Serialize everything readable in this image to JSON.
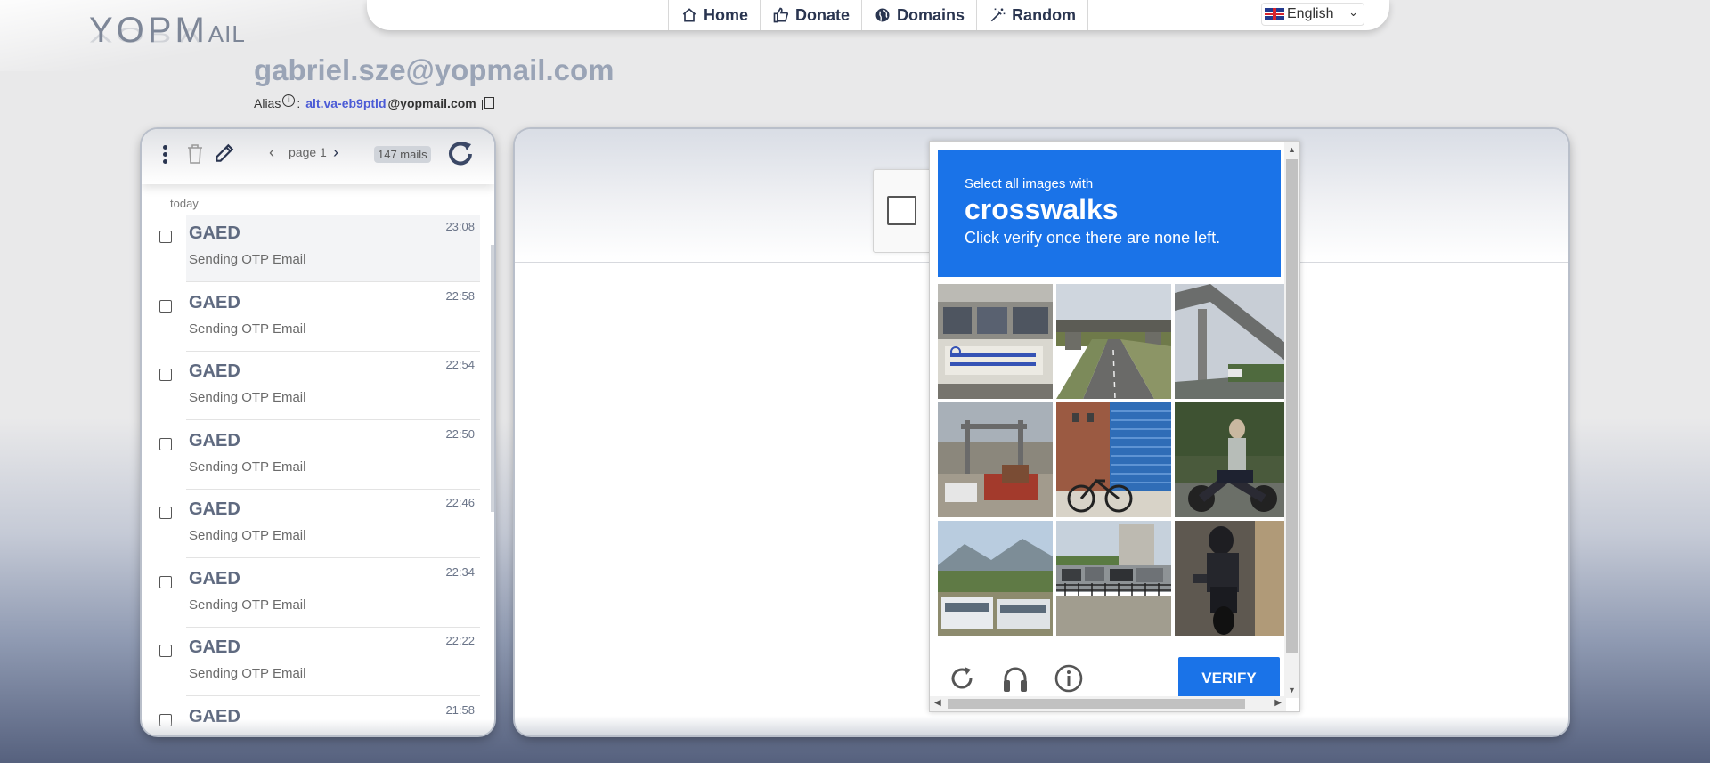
{
  "logo": {
    "text_main": "YOPM",
    "text_small": "AIL"
  },
  "nav": {
    "items": [
      {
        "label": "Home",
        "icon": "home-icon"
      },
      {
        "label": "Donate",
        "icon": "thumbs-up-icon"
      },
      {
        "label": "Domains",
        "icon": "globe-icon"
      },
      {
        "label": "Random",
        "icon": "magic-wand-icon"
      }
    ],
    "language": "English"
  },
  "mailbox": {
    "address": "gabriel.sze@yopmail.com",
    "alias_label": "Alias",
    "alias_sep": ":",
    "alias_name": "alt.va-eb9ptld",
    "alias_domain": "@yopmail.com"
  },
  "inbox": {
    "page_label": "page 1",
    "mail_count": "147 mails",
    "day_label": "today",
    "mails": [
      {
        "from": "GAED",
        "subject": "Sending OTP Email",
        "time": "23:08"
      },
      {
        "from": "GAED",
        "subject": "Sending OTP Email",
        "time": "22:58"
      },
      {
        "from": "GAED",
        "subject": "Sending OTP Email",
        "time": "22:54"
      },
      {
        "from": "GAED",
        "subject": "Sending OTP Email",
        "time": "22:50"
      },
      {
        "from": "GAED",
        "subject": "Sending OTP Email",
        "time": "22:46"
      },
      {
        "from": "GAED",
        "subject": "Sending OTP Email",
        "time": "22:34"
      },
      {
        "from": "GAED",
        "subject": "Sending OTP Email",
        "time": "22:22"
      },
      {
        "from": "GAED",
        "subject": "",
        "time": "21:58"
      }
    ]
  },
  "captcha": {
    "intro": "Select all images with",
    "target": "crosswalks",
    "note": "Click verify once there are none left.",
    "verify_label": "VERIFY",
    "accent": "#1a73e8"
  }
}
